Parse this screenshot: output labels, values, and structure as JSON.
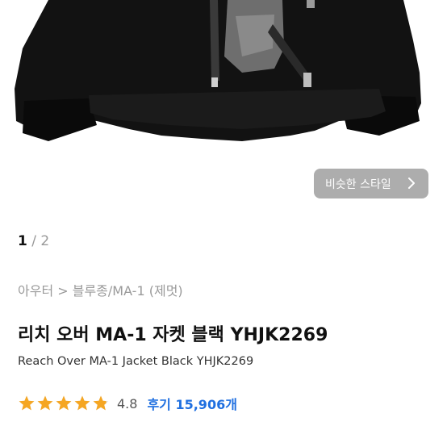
{
  "gallery": {
    "similar_style_label": "비슷한 스타일",
    "page_current": "1",
    "page_separator": "/",
    "page_total": "2"
  },
  "product": {
    "breadcrumb": "아우터 > 블루종/MA-1 (제멋)",
    "title_ko": "리치 오버 MA-1 자켓 블랙 YHJK2269",
    "title_en": "Reach Over MA-1 Jacket Black YHJK2269",
    "rating": {
      "stars_value": 4.8,
      "stars_max": 5,
      "score_text": "4.8",
      "reviews_text": "후기 15,906개"
    }
  },
  "colors": {
    "star": "#f5a623",
    "review_link": "#1f6fe0",
    "jacket": "#121212"
  }
}
